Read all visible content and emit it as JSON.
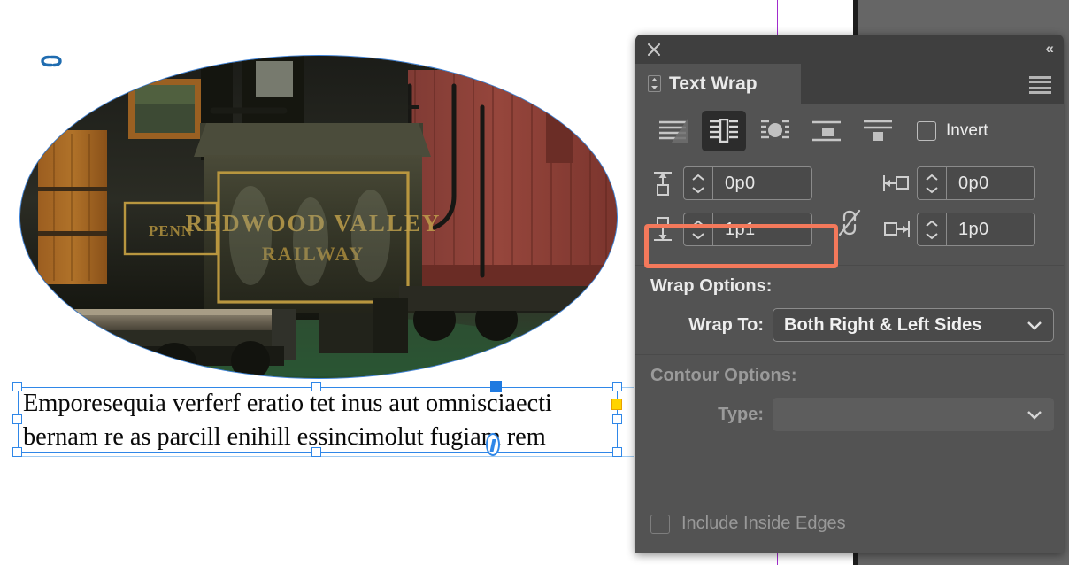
{
  "document": {
    "page_background": "#ffffff",
    "canvas_background": "#666666",
    "column_guide_color": "#a12ccd",
    "link_badge_icon": "link-chain-icon",
    "photo": {
      "name": "ellipse-clipped-photo",
      "description": "Vintage black locomotive with gold lettering beside a red boxcar",
      "shape": "ellipse"
    },
    "story": {
      "line1": "Emporesequia verferf eratio tet inus aut omnisciaecti",
      "line2": "bernam re as parcill enihill essincimolut fugiam rem"
    },
    "selection": {
      "frame_stroke": "#2f87e8",
      "wrap_boundary_stroke": "#9fcbf2",
      "corner_options_handle_color": "#ffd400"
    }
  },
  "panel": {
    "title": "Text Wrap",
    "close_icon": "close-icon",
    "collapse_icon": "double-chevron-left-icon",
    "menu_icon": "panel-menu-icon",
    "grip_icon": "panel-grip-icon",
    "wrap_modes": [
      {
        "name": "no-text-wrap",
        "icon": "no-wrap-icon",
        "active": false
      },
      {
        "name": "wrap-around-bounding-box",
        "icon": "bounding-box-wrap-icon",
        "active": true
      },
      {
        "name": "wrap-around-object-shape",
        "icon": "object-shape-wrap-icon",
        "active": false
      },
      {
        "name": "jump-object",
        "icon": "jump-object-icon",
        "active": false
      },
      {
        "name": "jump-to-next-column",
        "icon": "jump-next-column-icon",
        "active": false
      }
    ],
    "invert": {
      "label": "Invert",
      "checked": false
    },
    "offsets": {
      "top": {
        "icon": "offset-top-icon",
        "value": "0p0",
        "highlighted": false
      },
      "bottom": {
        "icon": "offset-bottom-icon",
        "value": "1p1",
        "highlighted": true
      },
      "left": {
        "icon": "offset-left-icon",
        "value": "0p0",
        "highlighted": false
      },
      "right": {
        "icon": "offset-right-icon",
        "value": "1p0",
        "highlighted": false
      },
      "link_icon": "broken-chain-link-icon",
      "highlight_color": "#f4795b"
    },
    "wrap_options": {
      "title": "Wrap Options:",
      "wrap_to_label": "Wrap To:",
      "wrap_to_value": "Both Right & Left Sides",
      "caret_icon": "chevron-down-icon"
    },
    "contour_options": {
      "title": "Contour Options:",
      "type_label": "Type:",
      "type_value": "",
      "caret_icon": "chevron-down-icon",
      "disabled": true
    },
    "include_inside_edges": {
      "label": "Include Inside Edges",
      "checked": false,
      "disabled": true
    }
  }
}
